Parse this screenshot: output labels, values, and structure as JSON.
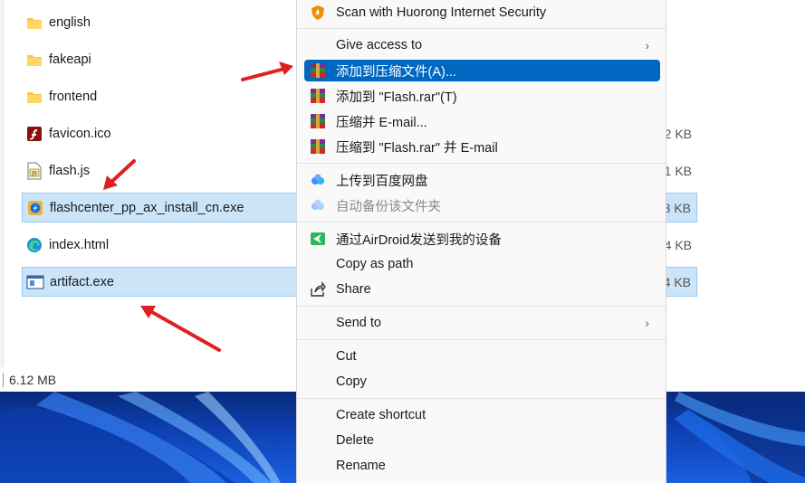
{
  "files": [
    {
      "name": "english",
      "icon": "folder-icon",
      "size": "",
      "selected": false
    },
    {
      "name": "fakeapi",
      "icon": "folder-icon",
      "size": "",
      "selected": false
    },
    {
      "name": "frontend",
      "icon": "folder-icon",
      "size": "",
      "selected": false
    },
    {
      "name": "favicon.ico",
      "icon": "flash-icon",
      "size": "2 KB",
      "selected": false
    },
    {
      "name": "flash.js",
      "icon": "js-file-icon",
      "size": "1 KB",
      "selected": false
    },
    {
      "name": "flashcenter_pp_ax_install_cn.exe",
      "icon": "flashcenter-icon",
      "size": "3 KB",
      "selected": true
    },
    {
      "name": "index.html",
      "icon": "edge-icon",
      "size": "4 KB",
      "selected": false
    },
    {
      "name": "artifact.exe",
      "icon": "exe-icon",
      "size": "4 KB",
      "selected": true
    }
  ],
  "status": {
    "selection_size": "6.12 MB"
  },
  "menu": {
    "scan": "Scan with Huorong Internet Security",
    "give_access": "Give access to",
    "add_archive": "添加到压缩文件(A)...",
    "add_flash_rar": "添加到 \"Flash.rar\"(T)",
    "compress_email": "压缩并 E-mail...",
    "compress_flash_email": "压缩到 \"Flash.rar\" 并 E-mail",
    "upload_baidu": "上传到百度网盘",
    "auto_backup": "自动备份该文件夹",
    "airdroid": "通过AirDroid发送到我的设备",
    "copy_path": "Copy as path",
    "share": "Share",
    "send_to": "Send to",
    "cut": "Cut",
    "copy": "Copy",
    "create_shortcut": "Create shortcut",
    "delete": "Delete",
    "rename": "Rename"
  },
  "colors": {
    "highlight": "#0067c0",
    "selection": "#cce4f7",
    "arrow": "#e02020"
  }
}
